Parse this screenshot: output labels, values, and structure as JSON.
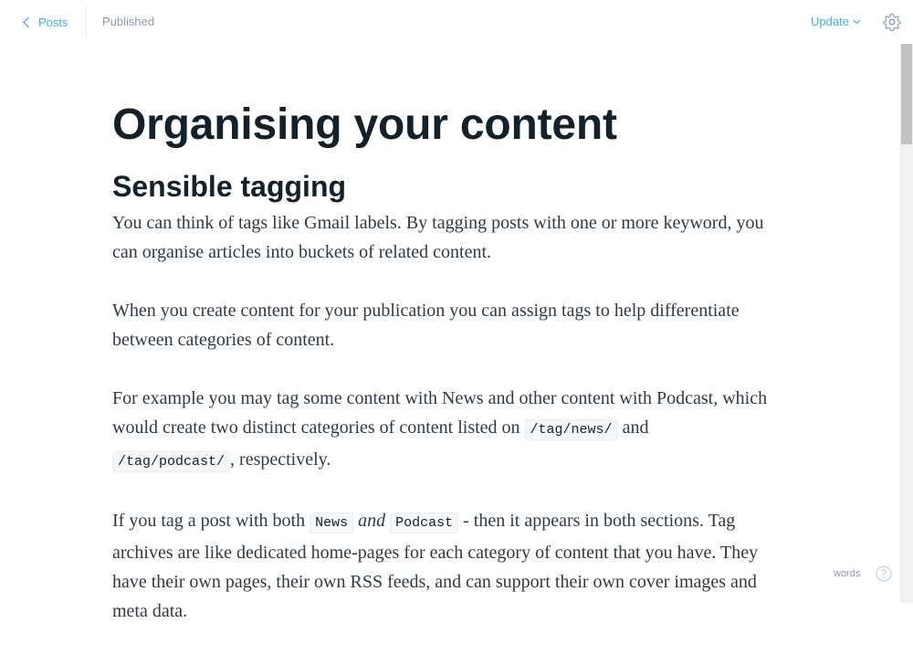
{
  "topbar": {
    "back_label": "Posts",
    "status": "Published",
    "update_label": "Update"
  },
  "post": {
    "title": "Organising your content",
    "heading": "Sensible tagging",
    "p1": "You can think of tags like Gmail labels. By tagging posts with one or more keyword, you can organise articles into buckets of related content.",
    "p2": "When you create content for your publication you can assign tags to help differentiate between categories of content.",
    "p3_a": "For example you may tag some content with News and other content with Podcast, which would create two distinct categories of content listed on ",
    "p3_code1": "/tag/news/",
    "p3_b": " and ",
    "p3_code2": "/tag/podcast/",
    "p3_c": ", respectively.",
    "p4_a": "If you tag a post with both ",
    "p4_code1": "News",
    "p4_em": "and",
    "p4_code2": "Podcast",
    "p4_b": " - then it appears in both sections. Tag archives are like dedicated home-pages for each category of content that you have. They have their own pages, their own RSS feeds, and can support their own cover images and meta data."
  },
  "footer": {
    "wordcount": "words"
  },
  "icons": {
    "back": "chevron-left-icon",
    "update": "chevron-down-icon",
    "settings": "gear-icon",
    "help": "question-circle-icon"
  },
  "colors": {
    "accent": "#3eb0ef",
    "text": "#15212a",
    "muted": "#8e9cac"
  }
}
